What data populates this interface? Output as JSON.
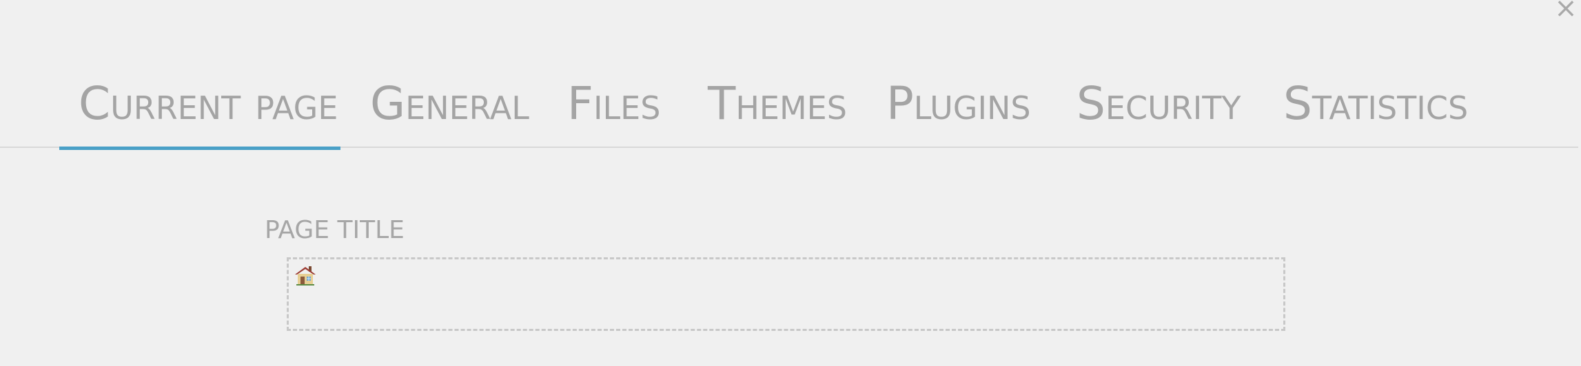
{
  "window": {
    "close_label": "×"
  },
  "tabs": [
    {
      "label": "Current page",
      "active": true
    },
    {
      "label": "General",
      "active": false
    },
    {
      "label": "Files",
      "active": false
    },
    {
      "label": "Themes",
      "active": false
    },
    {
      "label": "Plugins",
      "active": false
    },
    {
      "label": "Security",
      "active": false
    },
    {
      "label": "Statistics",
      "active": false
    }
  ],
  "page_title_field": {
    "label": "PAGE TITLE",
    "value": "",
    "icon": "home-icon"
  },
  "colors": {
    "background": "#f0f0f0",
    "text_muted": "#a4a4a4",
    "active_tab_underline": "#4aa0c7",
    "divider": "#d8d8d8",
    "dashed_border": "#c8c8c8"
  }
}
